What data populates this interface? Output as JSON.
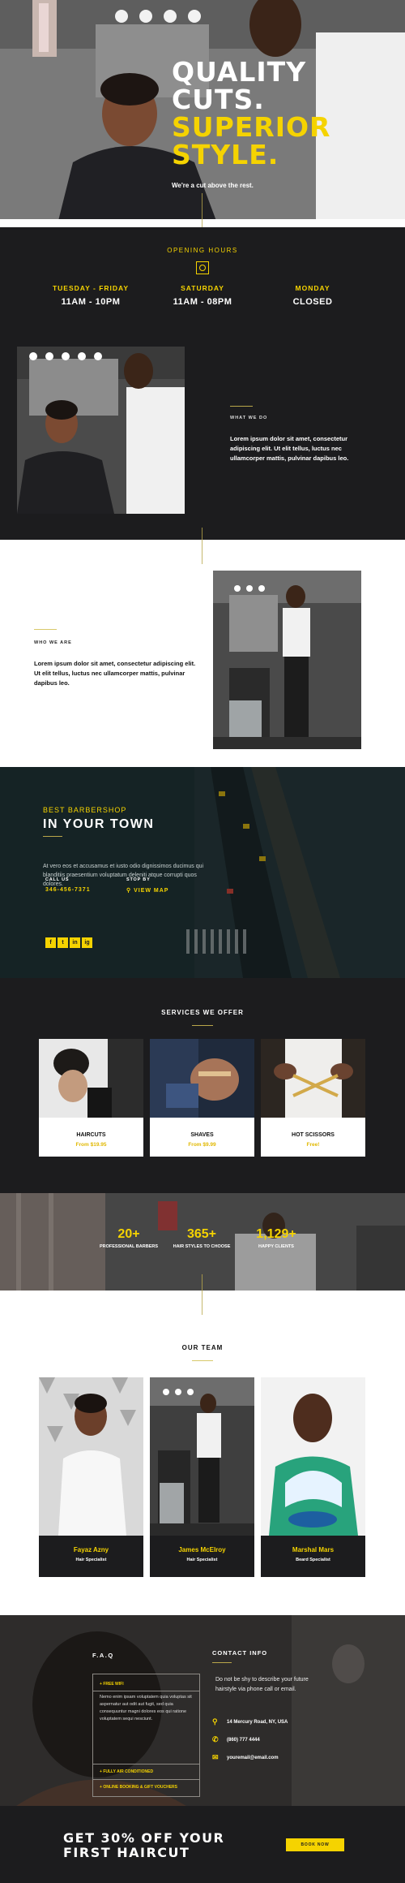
{
  "hero": {
    "title_line1": "QUALITY CUTS.",
    "title_line2": "SUPERIOR",
    "title_line3": "STYLE.",
    "subtitle": "We're a cut above the rest."
  },
  "hours": {
    "title": "OPENING HOURS",
    "days": [
      {
        "day": "TUESDAY - FRIDAY",
        "time": "11AM - 10PM"
      },
      {
        "day": "SATURDAY",
        "time": "11AM - 08PM"
      },
      {
        "day": "MONDAY",
        "time": "CLOSED"
      }
    ]
  },
  "what_we_do": {
    "label": "WHAT WE DO",
    "text": "Lorem ipsum dolor sit amet, consectetur adipiscing elit. Ut elit tellus, luctus nec ullamcorper mattis, pulvinar dapibus leo."
  },
  "who_we_are": {
    "label": "WHO WE ARE",
    "text": "Lorem ipsum dolor sit amet, consectetur adipiscing elit. Ut elit tellus, luctus nec ullamcorper mattis, pulvinar dapibus leo."
  },
  "town": {
    "eyebrow": "BEST BARBERSHOP",
    "title": "IN YOUR TOWN",
    "body": "At vero eos et accusamus et iusto odio dignissimos ducimus qui blanditiis praesentium voluptatum deleniti atque corrupti quos dolores.",
    "call_label": "CALL US",
    "call_value": "346-456-7371",
    "stop_label": "STOP BY",
    "stop_value": "VIEW MAP",
    "socials": [
      "f",
      "t",
      "in",
      "ig"
    ]
  },
  "services": {
    "title": "SERVICES WE OFFER",
    "items": [
      {
        "name": "HAIRCUTS",
        "price": "From $19.95"
      },
      {
        "name": "SHAVES",
        "price": "From $9.99"
      },
      {
        "name": "HOT SCISSORS",
        "price": "Free!"
      }
    ]
  },
  "stats": [
    {
      "num": "20+",
      "label": "PROFESSIONAL BARBERS"
    },
    {
      "num": "365+",
      "label": "HAIR STYLES TO CHOOSE"
    },
    {
      "num": "1,129+",
      "label": "HAPPY CLIENTS"
    }
  ],
  "team": {
    "title": "OUR TEAM",
    "members": [
      {
        "name": "Fayaz Azny",
        "role": "Hair Specialist"
      },
      {
        "name": "James McElroy",
        "role": "Hair Specialist"
      },
      {
        "name": "Marshal Mars",
        "role": "Beard Specialist"
      }
    ]
  },
  "faq": {
    "title": "F.A.Q",
    "q1": "FREE WIFI",
    "answer": "Nemo enim ipsam voluptatem quia voluptas sit aspernatur aut odit aut fugit, sed quia consequuntur magni dolores eos qui ratione voluptatem sequi nesciunt.",
    "q2": "FULLY AIR CONDITIONED",
    "q3": "ONLINE BOOKING & GIFT VOUCHERS"
  },
  "contact": {
    "title": "CONTACT INFO",
    "body": "Do not be shy to describe your future hairstyle via phone call or email.",
    "address": "14 Mercury Road, NY, USA",
    "phone": "(860) 777 4444",
    "email": "youremail@email.com"
  },
  "cta": {
    "line1": "GET 30% OFF YOUR",
    "line2": "FIRST HAIRCUT",
    "button": "BOOK NOW"
  },
  "colors": {
    "accent": "#f5d300",
    "dark": "#1c1c1e"
  }
}
